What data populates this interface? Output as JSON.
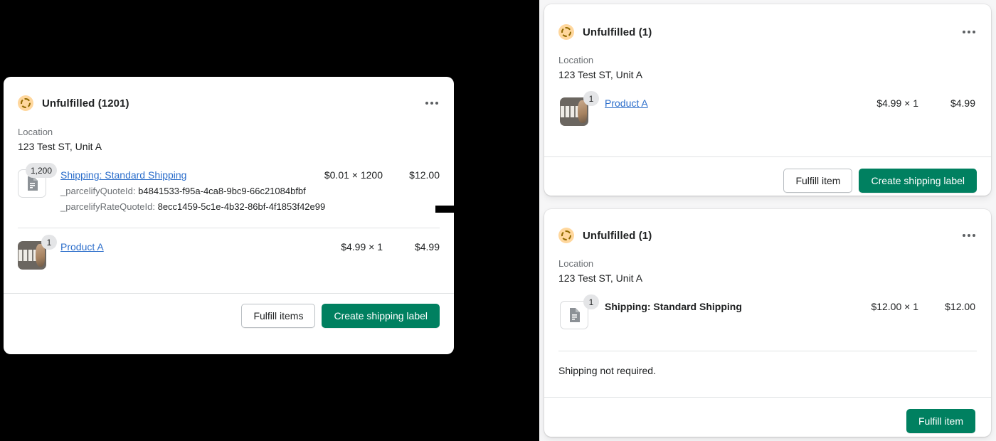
{
  "before_card": {
    "status_icon": "unfulfilled-circle-icon",
    "title": "Unfulfilled (1201)",
    "menu_icon": "kebab-menu-icon",
    "location_label": "Location",
    "location_value": "123 Test ST, Unit A",
    "lines": [
      {
        "icon": "document-icon",
        "qty_badge": "1,200",
        "name": "Shipping: Standard Shipping",
        "unit_price": "$0.01 × 1200",
        "total": "$12.00",
        "meta": [
          {
            "key": "_parcelifyQuoteId:",
            "value": "b4841533-f95a-4ca8-9bc9-66c21084bfbf"
          },
          {
            "key": "_parcelifyRateQuoteId:",
            "value": "8ecc1459-5c1e-4b32-86bf-4f1853f42e99"
          }
        ]
      },
      {
        "icon": "product-thumbnail",
        "qty_badge": "1",
        "name": "Product A",
        "unit_price": "$4.99 × 1",
        "total": "$4.99"
      }
    ],
    "buttons": {
      "secondary": "Fulfill items",
      "primary": "Create shipping label"
    }
  },
  "after_cards": [
    {
      "status_icon": "unfulfilled-circle-icon",
      "title": "Unfulfilled (1)",
      "menu_icon": "kebab-menu-icon",
      "location_label": "Location",
      "location_value": "123 Test ST, Unit A",
      "line": {
        "icon": "product-thumbnail",
        "qty_badge": "1",
        "name": "Product A",
        "unit_price": "$4.99 × 1",
        "total": "$4.99"
      },
      "buttons": {
        "secondary": "Fulfill item",
        "primary": "Create shipping label"
      }
    },
    {
      "status_icon": "unfulfilled-circle-icon",
      "title": "Unfulfilled (1)",
      "menu_icon": "kebab-menu-icon",
      "location_label": "Location",
      "location_value": "123 Test ST, Unit A",
      "line": {
        "icon": "document-icon",
        "qty_badge": "1",
        "name": "Shipping: Standard Shipping",
        "unit_price": "$12.00 × 1",
        "total": "$12.00"
      },
      "note": "Shipping not required.",
      "buttons": {
        "primary": "Fulfill item"
      }
    }
  ],
  "colors": {
    "primary_button": "#008060",
    "link": "#2c6ecb",
    "status_badge_bg": "#ffd79d",
    "status_badge_stroke": "#916a00",
    "panel_bg": "#f6f6f7",
    "backdrop": "#000000"
  }
}
